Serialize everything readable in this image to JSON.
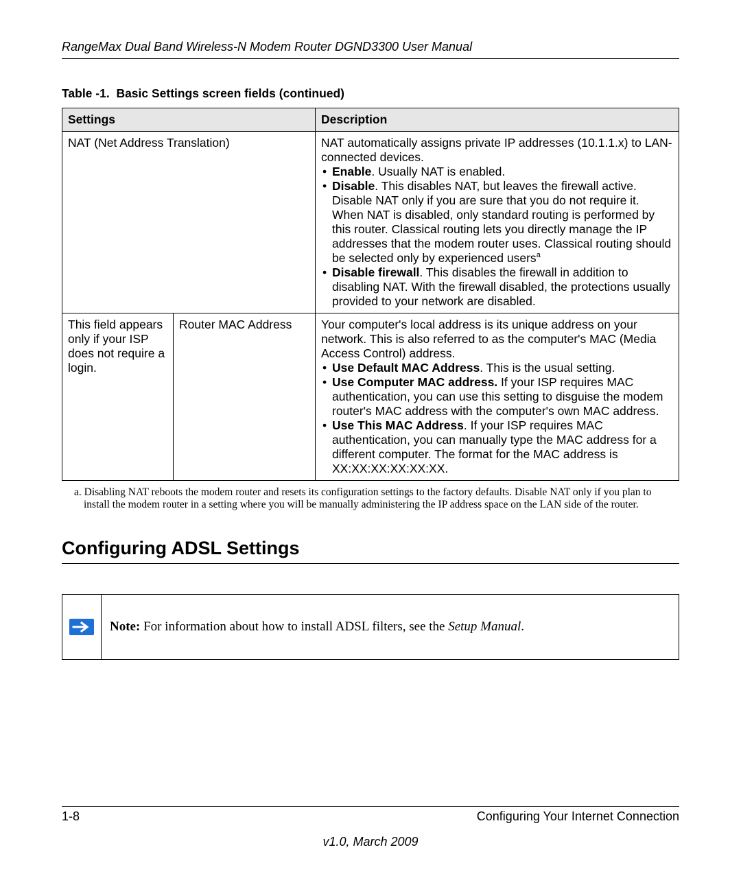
{
  "header": {
    "title": "RangeMax Dual Band Wireless-N Modem Router DGND3300 User Manual"
  },
  "table": {
    "caption_prefix": "Table -1.",
    "caption_text": "Basic Settings screen fields  (continued)",
    "col_settings": "Settings",
    "col_description": "Description",
    "rows": [
      {
        "setting_a": "NAT (Net Address Translation)",
        "setting_b": "",
        "desc_intro": "NAT automatically assigns private IP addresses (10.1.1.x) to LAN-connected devices.",
        "items": [
          {
            "label": "Enable",
            "text": ". Usually NAT is enabled."
          },
          {
            "label": "Disable",
            "text": ". This disables NAT, but leaves the firewall active. Disable NAT only if you are sure that you do not require it. When NAT is disabled, only standard routing is performed by this router. Classical routing lets you directly manage the IP addresses that the modem router uses. Classical routing should be selected only by experienced users",
            "sup": "a"
          },
          {
            "label": "Disable firewall",
            "text": ". This disables the firewall in addition to disabling NAT. With the firewall disabled, the protections usually provided to your network are disabled."
          }
        ]
      },
      {
        "setting_a": "This field appears only if your ISP does not require a login.",
        "setting_b": "Router MAC Address",
        "desc_intro": "Your computer's local address is its unique address on your network. This is also referred to as the computer's MAC (Media Access Control) address.",
        "items": [
          {
            "label": "Use Default MAC Address",
            "text": ". This is the usual setting."
          },
          {
            "label": "Use Computer MAC address.",
            "text": " If your ISP requires MAC authentication, you can use this setting to disguise the modem router's MAC address with the computer's own MAC address."
          },
          {
            "label": "Use This MAC Address",
            "text": ". If your ISP requires MAC authentication, you can manually type the MAC address for a different computer. The format for the MAC address is XX:XX:XX:XX:XX:XX."
          }
        ]
      }
    ]
  },
  "footnote": {
    "marker": "a.",
    "text": "Disabling NAT reboots the modem router and resets its configuration settings to the factory defaults. Disable NAT only if you plan to install the modem router in a setting where you will be manually administering the IP address space on the LAN side of the router."
  },
  "section_heading": "Configuring ADSL Settings",
  "note": {
    "label": "Note:",
    "text": " For information about how to install ADSL filters, see the ",
    "emph": "Setup Manual",
    "after": "."
  },
  "footer": {
    "page": "1-8",
    "chapter": "Configuring Your Internet Connection",
    "version": "v1.0, March 2009"
  },
  "chart_data": {
    "type": "table",
    "title": "Table -1. Basic Settings screen fields (continued)",
    "columns": [
      "Settings",
      "",
      "Description"
    ],
    "rows": [
      [
        "NAT (Net Address Translation)",
        "",
        "NAT automatically assigns private IP addresses (10.1.1.x) to LAN-connected devices. • Enable. Usually NAT is enabled. • Disable. This disables NAT, but leaves the firewall active. Disable NAT only if you are sure that you do not require it. When NAT is disabled, only standard routing is performed by this router. Classical routing lets you directly manage the IP addresses that the modem router uses. Classical routing should be selected only by experienced users. • Disable firewall. This disables the firewall in addition to disabling NAT. With the firewall disabled, the protections usually provided to your network are disabled."
      ],
      [
        "This field appears only if your ISP does not require a login.",
        "Router MAC Address",
        "Your computer's local address is its unique address on your network. This is also referred to as the computer's MAC (Media Access Control) address. • Use Default MAC Address. This is the usual setting. • Use Computer MAC address. If your ISP requires MAC authentication, you can use this setting to disguise the modem router's MAC address with the computer's own MAC address. • Use This MAC Address. If your ISP requires MAC authentication, you can manually type the MAC address for a different computer. The format for the MAC address is XX:XX:XX:XX:XX:XX."
      ]
    ]
  }
}
